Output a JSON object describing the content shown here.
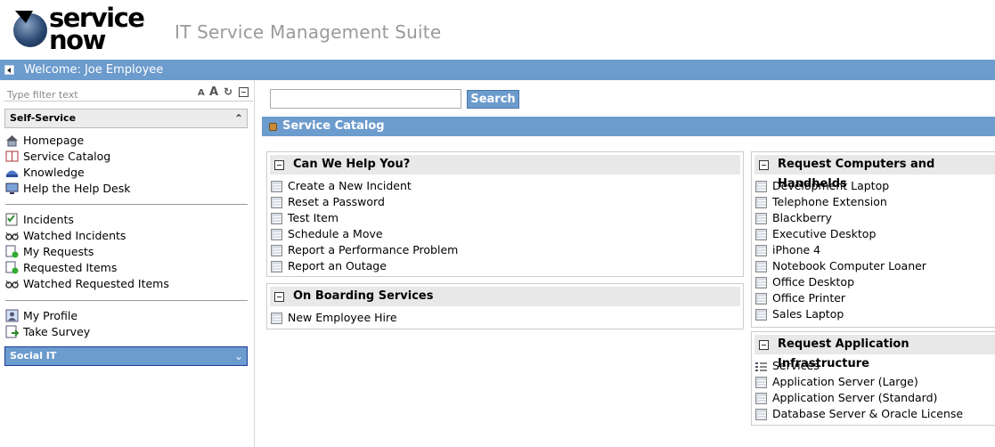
{
  "brand": {
    "logo_line1": "service",
    "logo_line2": "now",
    "suite_title": "IT Service Management Suite"
  },
  "welcome": {
    "text": "Welcome: Joe Employee"
  },
  "leftnav": {
    "filter_placeholder": "Type filter text",
    "apps": [
      {
        "title": "Self-Service",
        "groups": [
          [
            {
              "label": "Homepage",
              "icon": "home-icon"
            },
            {
              "label": "Service Catalog",
              "icon": "catalog-book-icon"
            },
            {
              "label": "Knowledge",
              "icon": "knowledge-icon"
            },
            {
              "label": "Help the Help Desk",
              "icon": "monitor-icon"
            }
          ],
          [
            {
              "label": "Incidents",
              "icon": "checklist-icon"
            },
            {
              "label": "Watched Incidents",
              "icon": "glasses-icon"
            },
            {
              "label": "My Requests",
              "icon": "request-icon"
            },
            {
              "label": "Requested Items",
              "icon": "request-icon"
            },
            {
              "label": "Watched Requested Items",
              "icon": "glasses-icon"
            }
          ],
          [
            {
              "label": "My Profile",
              "icon": "profile-icon"
            },
            {
              "label": "Take Survey",
              "icon": "survey-icon"
            }
          ]
        ]
      },
      {
        "title": "Social IT",
        "groups": []
      }
    ]
  },
  "search": {
    "value": "",
    "button_label": "Search"
  },
  "catalog": {
    "title": "Service Catalog",
    "panels": {
      "can_we_help": {
        "title": "Can We Help You?",
        "items": [
          "Create a New Incident",
          "Reset a Password",
          "Test Item",
          "Schedule a Move",
          "Report a Performance Problem",
          "Report an Outage"
        ]
      },
      "on_boarding": {
        "title": "On Boarding Services",
        "items": [
          "New Employee Hire"
        ]
      },
      "computers": {
        "title": "Request Computers and Handhelds",
        "items": [
          "Development Laptop",
          "Telephone Extension",
          "Blackberry",
          "Executive Desktop",
          "iPhone 4",
          "Notebook Computer Loaner",
          "Office Desktop",
          "Office Printer",
          "Sales Laptop"
        ]
      },
      "app_infra": {
        "title": "Request Application Infrastructure",
        "items": [
          "Services",
          "Application Server (Large)",
          "Application Server (Standard)",
          "Database Server & Oracle License"
        ]
      }
    }
  },
  "colors": {
    "accent": "#6c9bcd",
    "title_gray": "#9a9a9a"
  }
}
